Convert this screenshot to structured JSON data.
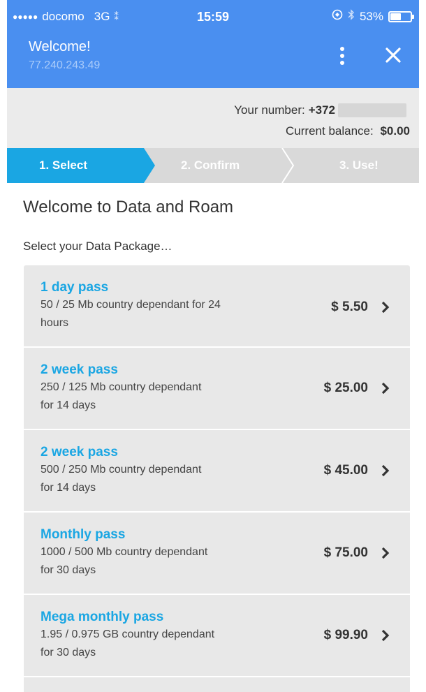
{
  "status_bar": {
    "carrier": "docomo",
    "network": "3G",
    "time": "15:59",
    "battery_percent": "53%",
    "battery_level": 0.53
  },
  "app_bar": {
    "title": "Welcome!",
    "subtitle": "77.240.243.49",
    "menu_icon": "more-vertical-icon",
    "close_icon": "close-icon"
  },
  "account": {
    "number_label": "Your number:",
    "number_prefix": "+372",
    "balance_label": "Current balance:",
    "balance_value": "$0.00"
  },
  "steps": [
    {
      "label": "1. Select",
      "active": true
    },
    {
      "label": "2. Confirm",
      "active": false
    },
    {
      "label": "3. Use!",
      "active": false
    }
  ],
  "main": {
    "title": "Welcome to Data and Roam",
    "subtitle": "Select your Data Package…"
  },
  "packages": [
    {
      "name": "1 day pass",
      "description": "50 / 25 Mb  country dependant  for 24\nhours",
      "price": "$ 5.50"
    },
    {
      "name": "2 week pass",
      "description": "250 / 125 Mb  country dependant\n for 14 days",
      "price": "$ 25.00"
    },
    {
      "name": "2 week pass",
      "description": "500 / 250 Mb  country dependant\n for 14 days",
      "price": "$ 45.00"
    },
    {
      "name": "Monthly pass",
      "description": "1000 / 500 Mb  country dependant\n for 30 days",
      "price": "$ 75.00"
    },
    {
      "name": "Mega monthly pass",
      "description": "1.95 / 0.975 GB  country dependant\n for 30 days",
      "price": "$ 99.90"
    }
  ],
  "colors": {
    "header": "#4a8ff0",
    "active_step": "#1aa6e3",
    "inactive_step": "#d9d9d9",
    "package_name": "#1aa6e3"
  }
}
